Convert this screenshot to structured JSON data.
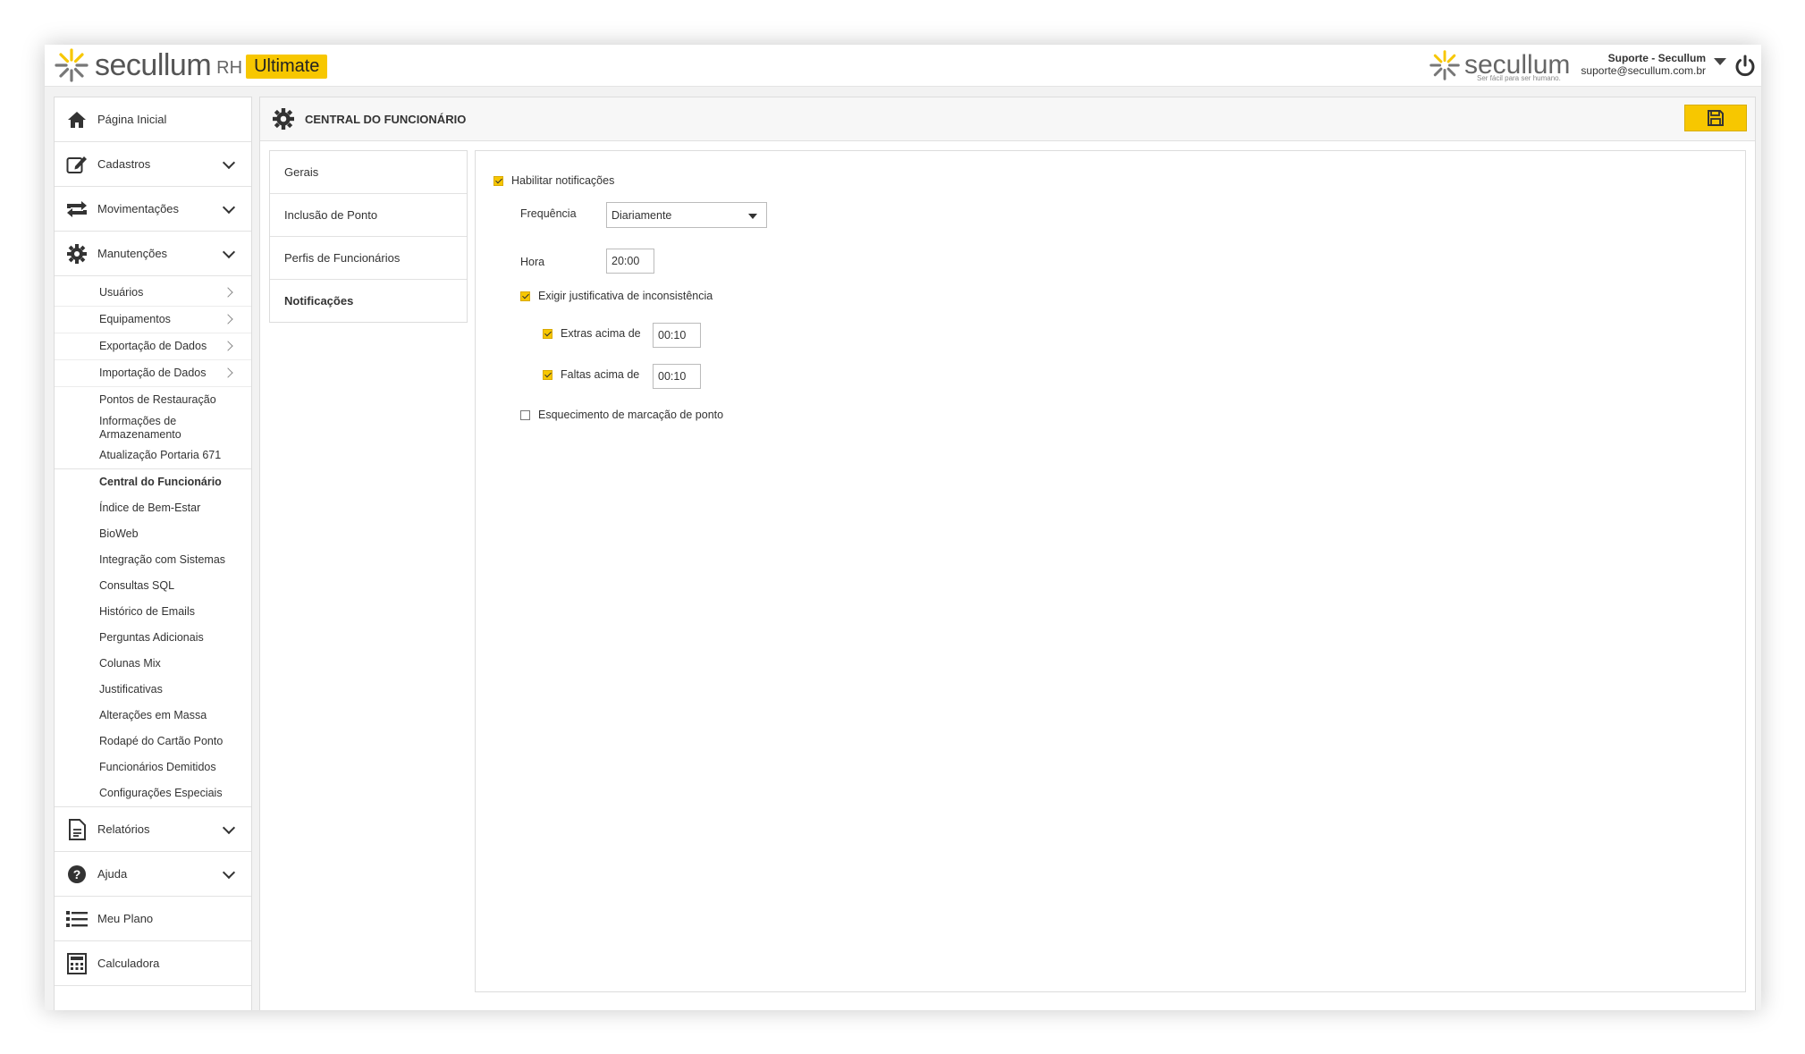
{
  "header": {
    "brand": "secullum",
    "product": "RH",
    "edition": "Ultimate",
    "right_brand": "secullum",
    "right_tagline": "Ser fácil para ser humano.",
    "user_name": "Suporte - Secullum",
    "user_email": "suporte@secullum.com.br",
    "accent_color": "#f7c700"
  },
  "sidebar": {
    "top_items": [
      {
        "label": "Página Inicial",
        "icon": "home-icon"
      },
      {
        "label": "Cadastros",
        "icon": "edit-icon"
      },
      {
        "label": "Movimentações",
        "icon": "exchange-icon"
      },
      {
        "label": "Manutenções",
        "icon": "gear-icon"
      }
    ],
    "manutencoes_items": [
      "Usuários",
      "Equipamentos",
      "Exportação de Dados",
      "Importação de Dados",
      "Pontos de Restauração",
      "Informações de Armazenamento",
      "Atualização Portaria 671",
      "Central do Funcionário",
      "Índice de Bem-Estar",
      "BioWeb",
      "Integração com Sistemas",
      "Consultas SQL",
      "Histórico de Emails",
      "Perguntas Adicionais",
      "Colunas Mix",
      "Justificativas",
      "Alterações em Massa",
      "Rodapé do Cartão Ponto",
      "Funcionários Demitidos",
      "Configurações Especiais"
    ],
    "bottom_items": [
      {
        "label": "Relatórios",
        "icon": "document-icon"
      },
      {
        "label": "Ajuda",
        "icon": "help-icon"
      },
      {
        "label": "Meu Plano",
        "icon": "list-icon"
      },
      {
        "label": "Calculadora",
        "icon": "calculator-icon"
      }
    ]
  },
  "main": {
    "title": "CENTRAL DO FUNCIONÁRIO",
    "tabs": [
      "Gerais",
      "Inclusão de Ponto",
      "Perfis de Funcionários",
      "Notificações"
    ],
    "active_tab": "Notificações"
  },
  "form": {
    "enable_notifications_label": "Habilitar notificações",
    "enable_notifications_checked": true,
    "frequency_label": "Frequência",
    "frequency_value": "Diariamente",
    "time_label": "Hora",
    "time_value": "20:00",
    "require_justification_label": "Exigir justificativa de inconsistência",
    "require_justification_checked": true,
    "extras_label": "Extras acima de",
    "extras_checked": true,
    "extras_value": "00:10",
    "faltas_label": "Faltas acima de",
    "faltas_checked": true,
    "faltas_value": "00:10",
    "forgot_punch_label": "Esquecimento de marcação de ponto",
    "forgot_punch_checked": false
  }
}
